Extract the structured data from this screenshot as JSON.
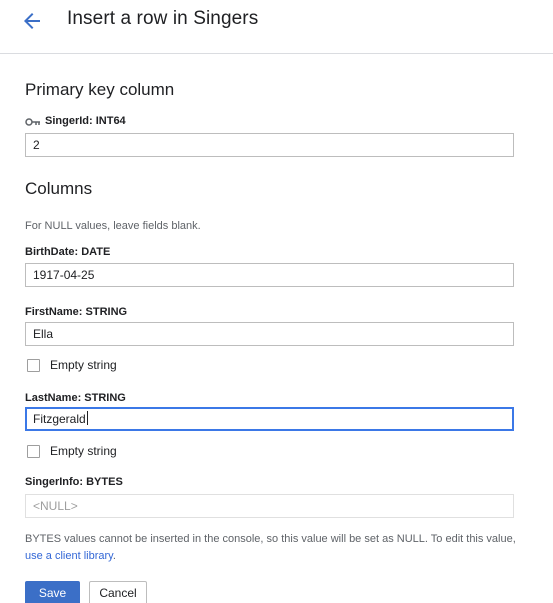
{
  "header": {
    "title": "Insert a row in Singers"
  },
  "primary_key": {
    "section_title": "Primary key column",
    "field": {
      "label": "SingerId: INT64",
      "value": "2"
    }
  },
  "columns": {
    "section_title": "Columns",
    "note": "For NULL values, leave fields blank.",
    "birthdate": {
      "label": "BirthDate: DATE",
      "value": "1917-04-25"
    },
    "firstname": {
      "label": "FirstName: STRING",
      "value": "Ella",
      "empty_string_label": "Empty string",
      "empty_string_checked": false
    },
    "lastname": {
      "label": "LastName: STRING",
      "value": "Fitzgerald",
      "empty_string_label": "Empty string",
      "empty_string_checked": false
    },
    "singerinfo": {
      "label": "SingerInfo: BYTES",
      "placeholder": "<NULL>"
    }
  },
  "footnote": {
    "text_before_link": "BYTES values cannot be inserted in the console, so this value will be set as NULL. To edit this value, ",
    "link_text": "use a client library",
    "text_after_link": "."
  },
  "actions": {
    "save_label": "Save",
    "cancel_label": "Cancel"
  },
  "colors": {
    "accent": "#3b6fc7",
    "link": "#3367d6",
    "focus": "#3b78e7"
  },
  "icons": {
    "back": "arrow-back-icon",
    "key": "key-icon"
  }
}
